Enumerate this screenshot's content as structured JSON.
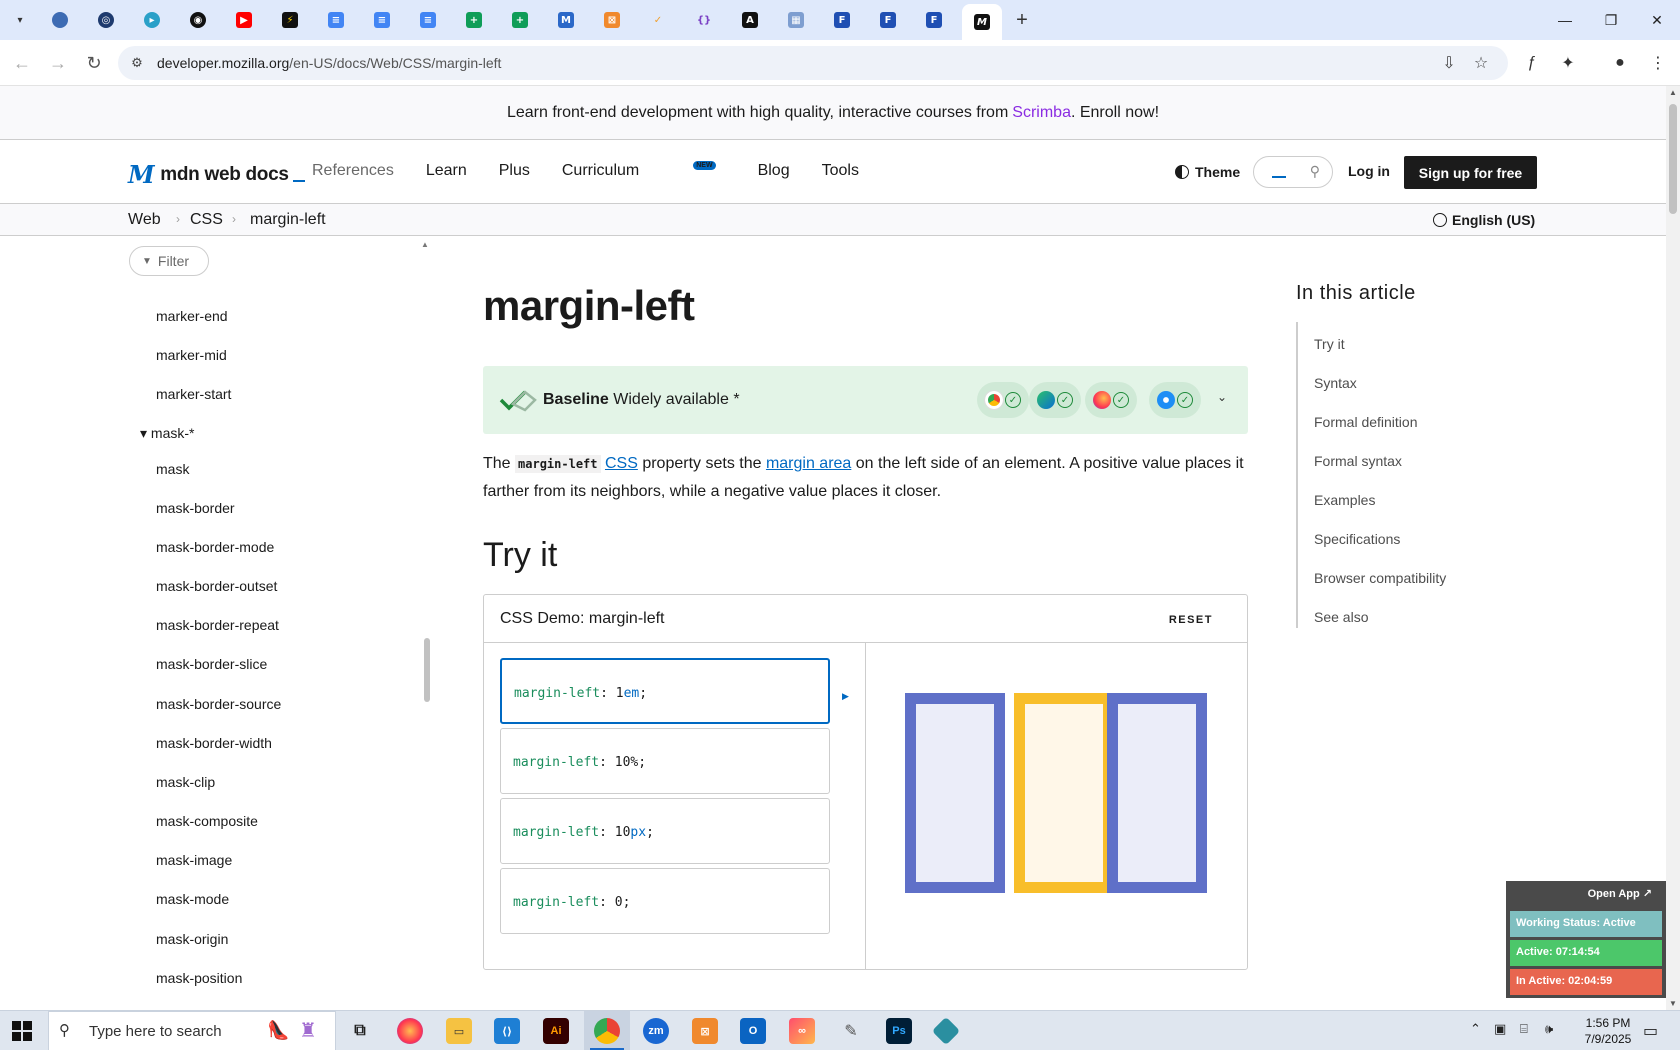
{
  "browser": {
    "url_host": "developer.mozilla.org",
    "url_path": "/en-US/docs/Web/CSS/margin-left",
    "new_tab_symbol": "+"
  },
  "banner": {
    "text_before": "Learn front-end development with high quality, interactive courses from",
    "link": "Scrimba",
    "text_after": ". Enroll now!"
  },
  "header": {
    "logo_mark": "M",
    "logo_text": "mdn web docs",
    "nav": [
      "References",
      "Learn",
      "Plus",
      "Curriculum",
      "Blog",
      "Tools"
    ],
    "new_badge": "NEW",
    "theme_label": "Theme",
    "login_label": "Log in",
    "signup_label": "Sign up for free"
  },
  "breadcrumbs": [
    "Web",
    "CSS",
    "margin-left"
  ],
  "language": "English (US)",
  "sidebar": {
    "filter_label": "Filter",
    "items_before_group": [
      "marker-end",
      "marker-mid",
      "marker-start"
    ],
    "group_label": "mask-*",
    "group_items": [
      "mask",
      "mask-border",
      "mask-border-mode",
      "mask-border-outset",
      "mask-border-repeat",
      "mask-border-slice",
      "mask-border-source",
      "mask-border-width",
      "mask-clip",
      "mask-composite",
      "mask-image",
      "mask-mode",
      "mask-origin",
      "mask-position"
    ]
  },
  "article": {
    "title": "margin-left",
    "baseline_label": "Baseline",
    "baseline_status": "Widely available *",
    "desc_1": "The",
    "desc_code": "margin-left",
    "desc_link1": "CSS",
    "desc_2": "property sets the",
    "desc_link2": "margin area",
    "desc_3": "on the left side of an element. A positive value places it farther from its neighbors, while a negative value places it closer.",
    "tryit_heading": "Try it",
    "demo_title": "CSS Demo: margin-left",
    "reset_label": "RESET",
    "choices": [
      {
        "prop": "margin-left",
        "num": "1",
        "unit": "em"
      },
      {
        "prop": "margin-left",
        "num": "10",
        "unit": "%"
      },
      {
        "prop": "margin-left",
        "num": "10",
        "unit": "px"
      },
      {
        "prop": "margin-left",
        "num": "0",
        "unit": ""
      }
    ],
    "selected_choice": 0
  },
  "toc": {
    "title": "In this article",
    "items": [
      "Try it",
      "Syntax",
      "Formal definition",
      "Formal syntax",
      "Examples",
      "Specifications",
      "Browser compatibility",
      "See also"
    ]
  },
  "widget": {
    "open_app": "Open App ↗",
    "working_status": "Working Status: Active",
    "active": "Active: 07:14:54",
    "inactive": "In Active: 02:04:59"
  },
  "taskbar": {
    "search_placeholder": "Type here to search",
    "time": "1:56 PM",
    "date": "7/9/2025"
  },
  "colors": {
    "mdn_blue": "#0069c2",
    "baseline_bg": "#e3f4e7",
    "demo_blue": "#5f70c8",
    "demo_yellow": "#f8be2a",
    "scrimba_purple": "#8a2be2"
  }
}
